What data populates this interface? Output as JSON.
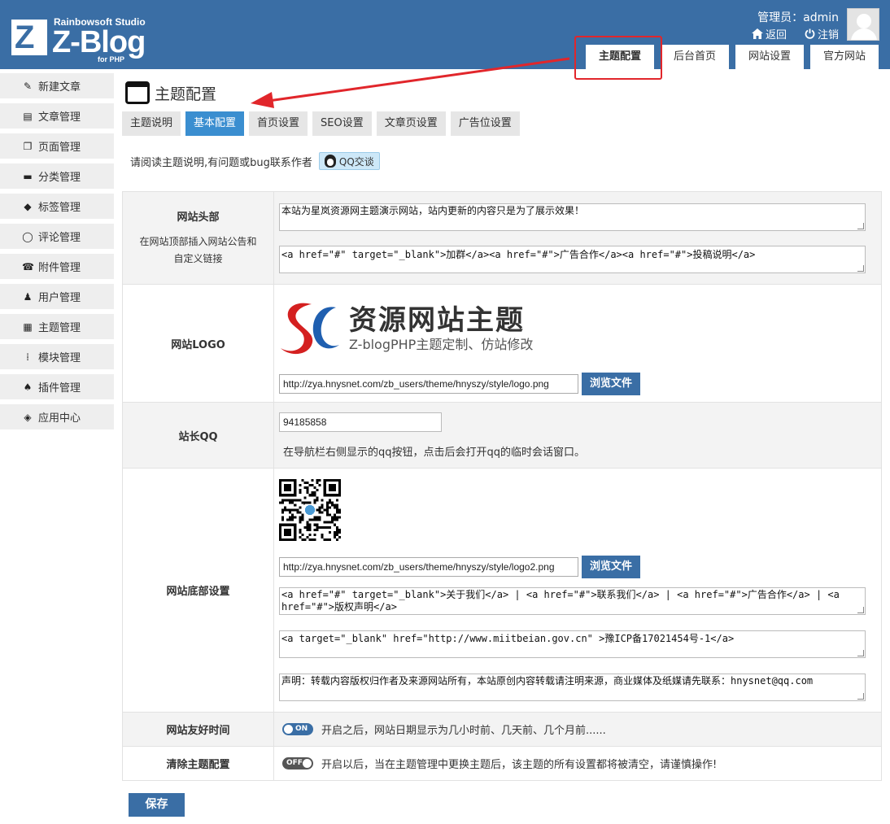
{
  "header": {
    "studio": "Rainbowsoft Studio",
    "brand": "Z-Blog",
    "brand_sub": "for PHP",
    "logo_letter": "Z",
    "admin_label": "管理员：admin",
    "back_link": "返回",
    "logout_link": "注销",
    "tabs": [
      "主题配置",
      "后台首页",
      "网站设置",
      "官方网站"
    ]
  },
  "sidebar": {
    "items": [
      {
        "label": "新建文章",
        "icon": "edit-icon"
      },
      {
        "label": "文章管理",
        "icon": "document-icon"
      },
      {
        "label": "页面管理",
        "icon": "pages-icon"
      },
      {
        "label": "分类管理",
        "icon": "folder-icon"
      },
      {
        "label": "标签管理",
        "icon": "tag-icon"
      },
      {
        "label": "评论管理",
        "icon": "comment-icon"
      },
      {
        "label": "附件管理",
        "icon": "attachment-icon"
      },
      {
        "label": "用户管理",
        "icon": "user-icon"
      },
      {
        "label": "主题管理",
        "icon": "theme-icon"
      },
      {
        "label": "模块管理",
        "icon": "module-icon"
      },
      {
        "label": "插件管理",
        "icon": "plugin-icon"
      },
      {
        "label": "应用中心",
        "icon": "app-center-icon"
      }
    ]
  },
  "main": {
    "title": "主题配置",
    "sub_tabs": [
      "主题说明",
      "基本配置",
      "首页设置",
      "SEO设置",
      "文章页设置",
      "广告位设置"
    ],
    "notice": "请阅读主题说明,有问题或bug联系作者",
    "qq_button": "QQ交谈",
    "rows": {
      "header": {
        "label": "网站头部",
        "desc_1": "在网站顶部插入网站公告和",
        "desc_2": "自定义链接",
        "notice_value": "本站为星岚资源网主题演示网站，站内更新的内容只是为了展示效果！",
        "links_value": "<a href=\"#\" target=\"_blank\">加群</a><a href=\"#\">广告合作</a><a href=\"#\">投稿说明</a>"
      },
      "logo": {
        "label": "网站LOGO",
        "logo_title": "资源网站主题",
        "logo_subtitle": "Z-blogPHP主题定制、仿站修改",
        "url": "http://zya.hnysnet.com/zb_users/theme/hnyszy/style/logo.png",
        "browse": "浏览文件"
      },
      "qq": {
        "label": "站长QQ",
        "value": "94185858",
        "hint": "在导航栏右侧显示的qq按钮，点击后会打开qq的临时会话窗口。"
      },
      "footer": {
        "label": "网站底部设置",
        "qr_url": "http://zya.hnysnet.com/zb_users/theme/hnyszy/style/logo2.png",
        "browse": "浏览文件",
        "links_value": "<a href=\"#\" target=\"_blank\">关于我们</a> | <a href=\"#\">联系我们</a> | <a href=\"#\">广告合作</a> | <a href=\"#\">版权声明</a>",
        "icp_value": " <a target=\"_blank\" href=\"http://www.miitbeian.gov.cn\" >豫ICP备17021454号-1</a>",
        "statement_value": "声明：转载内容版权归作者及来源网站所有，本站原创内容转载请注明来源，商业媒体及纸媒请先联系：hnysnet@qq.com"
      },
      "friendly_time": {
        "label": "网站友好时间",
        "toggle": "ON",
        "desc": "开启之后，网站日期显示为几小时前、几天前、几个月前......"
      },
      "clear_config": {
        "label": "清除主题配置",
        "toggle": "OFF",
        "desc": "开启以后，当在主题管理中更换主题后，该主题的所有设置都将被清空，请谨慎操作!"
      }
    },
    "save": "保存"
  },
  "colors": {
    "header_bg": "#3a6ea5",
    "active_subtab": "#3a8ed0",
    "annotation_red": "#e1262b"
  }
}
